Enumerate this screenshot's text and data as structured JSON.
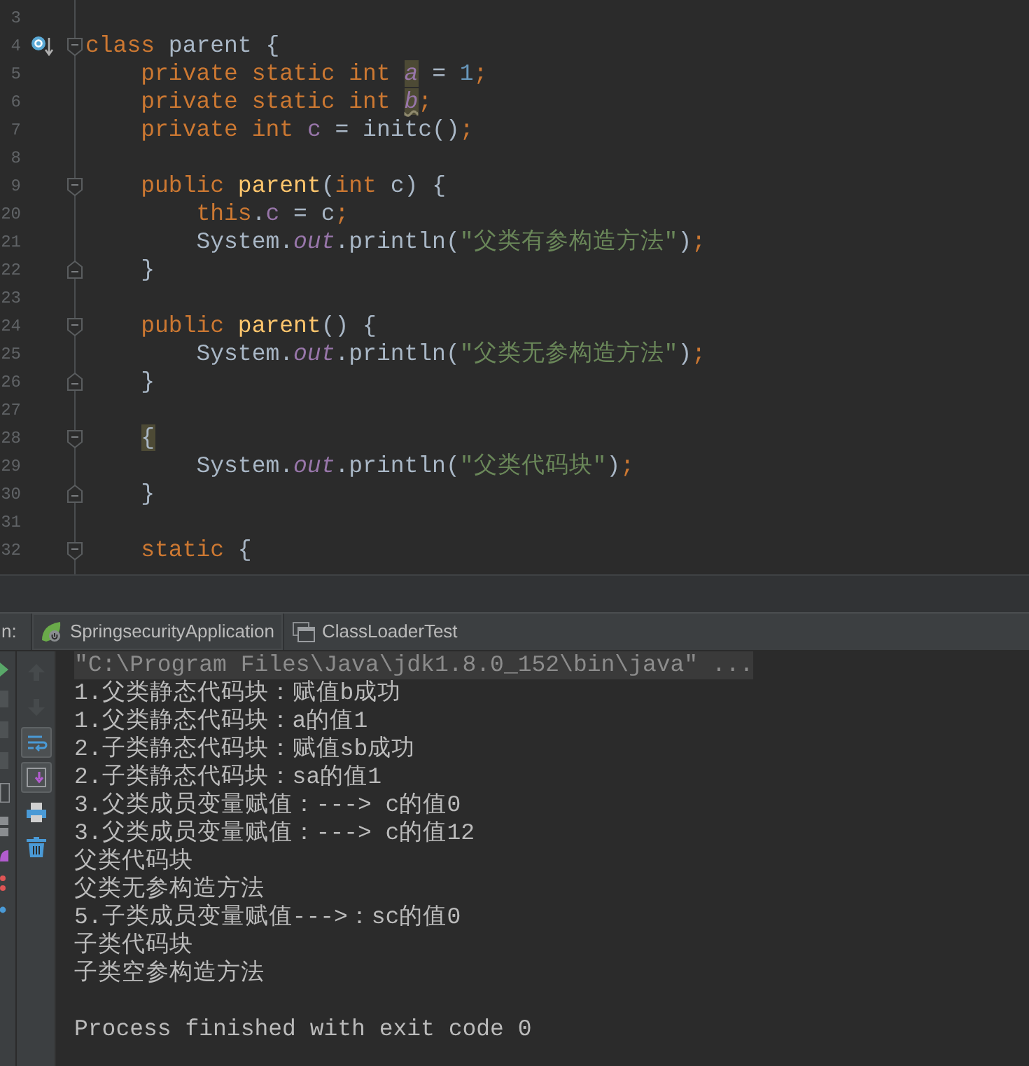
{
  "editor": {
    "lines": [
      {
        "number": "3"
      },
      {
        "number": "4",
        "override": true,
        "fold_start": true,
        "tokens": [
          {
            "kind": "keyword",
            "text": "class"
          },
          {
            "kind": "plain",
            "text": " parent {"
          }
        ]
      },
      {
        "number": "5",
        "tokens": [
          {
            "kind": "keyword",
            "text": "    private static int "
          },
          {
            "kind": "static-field",
            "text": "a",
            "highlighted": true
          },
          {
            "kind": "plain",
            "text": " = "
          },
          {
            "kind": "number",
            "text": "1"
          },
          {
            "kind": "keyword",
            "text": ";"
          }
        ]
      },
      {
        "number": "6",
        "tokens": [
          {
            "kind": "keyword",
            "text": "    private static int "
          },
          {
            "kind": "static-field",
            "text": "b",
            "highlighted": true,
            "warning": true
          },
          {
            "kind": "keyword",
            "text": ";"
          }
        ]
      },
      {
        "number": "7",
        "tokens": [
          {
            "kind": "keyword",
            "text": "    private int "
          },
          {
            "kind": "field",
            "text": "c"
          },
          {
            "kind": "plain",
            "text": " = initc()"
          },
          {
            "kind": "keyword",
            "text": ";"
          }
        ]
      },
      {
        "number": "8"
      },
      {
        "number": "9",
        "fold_start": true,
        "tokens": [
          {
            "kind": "keyword",
            "text": "    public "
          },
          {
            "kind": "method",
            "text": "parent"
          },
          {
            "kind": "plain",
            "text": "("
          },
          {
            "kind": "keyword",
            "text": "int "
          },
          {
            "kind": "plain",
            "text": "c) {"
          }
        ]
      },
      {
        "number": "20",
        "tokens": [
          {
            "kind": "keyword",
            "text": "        this"
          },
          {
            "kind": "plain",
            "text": "."
          },
          {
            "kind": "field",
            "text": "c"
          },
          {
            "kind": "plain",
            "text": " = c"
          },
          {
            "kind": "keyword",
            "text": ";"
          }
        ]
      },
      {
        "number": "21",
        "tokens": [
          {
            "kind": "plain",
            "text": "        System."
          },
          {
            "kind": "static-field",
            "text": "out"
          },
          {
            "kind": "plain",
            "text": ".println("
          },
          {
            "kind": "string",
            "text": "\"父类有参构造方法\""
          },
          {
            "kind": "plain",
            "text": ")"
          },
          {
            "kind": "keyword",
            "text": ";"
          }
        ]
      },
      {
        "number": "22",
        "fold_end": true,
        "tokens": [
          {
            "kind": "plain",
            "text": "    }"
          }
        ]
      },
      {
        "number": "23"
      },
      {
        "number": "24",
        "fold_start": true,
        "tokens": [
          {
            "kind": "keyword",
            "text": "    public "
          },
          {
            "kind": "method",
            "text": "parent"
          },
          {
            "kind": "plain",
            "text": "() {"
          }
        ]
      },
      {
        "number": "25",
        "tokens": [
          {
            "kind": "plain",
            "text": "        System."
          },
          {
            "kind": "static-field",
            "text": "out"
          },
          {
            "kind": "plain",
            "text": ".println("
          },
          {
            "kind": "string",
            "text": "\"父类无参构造方法\""
          },
          {
            "kind": "plain",
            "text": ")"
          },
          {
            "kind": "keyword",
            "text": ";"
          }
        ]
      },
      {
        "number": "26",
        "fold_end": true,
        "tokens": [
          {
            "kind": "plain",
            "text": "    }"
          }
        ]
      },
      {
        "number": "27"
      },
      {
        "number": "28",
        "fold_start": true,
        "tokens": [
          {
            "kind": "plain",
            "text": "    {",
            "highlighted": true
          }
        ]
      },
      {
        "number": "29",
        "tokens": [
          {
            "kind": "plain",
            "text": "        System."
          },
          {
            "kind": "static-field",
            "text": "out"
          },
          {
            "kind": "plain",
            "text": ".println("
          },
          {
            "kind": "string",
            "text": "\"父类代码块\""
          },
          {
            "kind": "plain",
            "text": ")"
          },
          {
            "kind": "keyword",
            "text": ";"
          }
        ]
      },
      {
        "number": "30",
        "fold_end": true,
        "tokens": [
          {
            "kind": "plain",
            "text": "    }"
          }
        ]
      },
      {
        "number": "31"
      },
      {
        "number": "32",
        "fold_start": true,
        "tokens": [
          {
            "kind": "keyword",
            "text": "    static "
          },
          {
            "kind": "plain",
            "text": "{"
          }
        ]
      }
    ]
  },
  "run_panel": {
    "label": "n:",
    "tabs": [
      {
        "label": "SpringsecurityApplication",
        "selected": true
      },
      {
        "label": "ClassLoaderTest",
        "selected": false
      }
    ],
    "toolbar": [
      {
        "disabled": true,
        "selected": false
      },
      {
        "disabled": true,
        "selected": false
      },
      {
        "disabled": false,
        "selected": true
      },
      {
        "disabled": false,
        "selected": true
      },
      {
        "disabled": false,
        "selected": false
      },
      {
        "disabled": false,
        "selected": false
      }
    ],
    "output": [
      {
        "kind": "command",
        "text": "\"C:\\Program Files\\Java\\jdk1.8.0_152\\bin\\java\" ..."
      },
      {
        "kind": "stdout",
        "text": "1.父类静态代码块：赋值b成功"
      },
      {
        "kind": "stdout",
        "text": "1.父类静态代码块：a的值1"
      },
      {
        "kind": "stdout",
        "text": "2.子类静态代码块：赋值sb成功"
      },
      {
        "kind": "stdout",
        "text": "2.子类静态代码块：sa的值1"
      },
      {
        "kind": "stdout",
        "text": "3.父类成员变量赋值：---> c的值0"
      },
      {
        "kind": "stdout",
        "text": "3.父类成员变量赋值：---> c的值12"
      },
      {
        "kind": "stdout",
        "text": "父类代码块"
      },
      {
        "kind": "stdout",
        "text": "父类无参构造方法"
      },
      {
        "kind": "stdout",
        "text": "5.子类成员变量赋值--->：sc的值0"
      },
      {
        "kind": "stdout",
        "text": "子类代码块"
      },
      {
        "kind": "stdout",
        "text": "子类空参构造方法"
      },
      {
        "kind": "blank"
      },
      {
        "kind": "stdout",
        "text": "Process finished with exit code 0"
      }
    ]
  }
}
